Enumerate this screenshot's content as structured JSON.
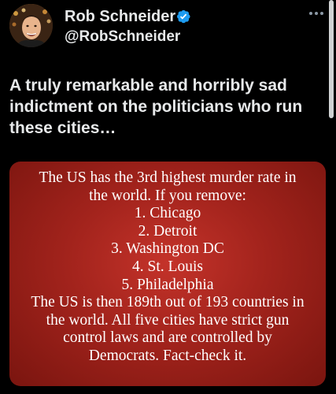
{
  "author": {
    "display_name": "Rob Schneider",
    "handle": "@RobSchneider",
    "verified": true
  },
  "tweet": {
    "text": "A truly remarkable and horribly sad indictment on the politicians who run these cities…"
  },
  "media": {
    "background_color": "#b32a22",
    "text_color": "#ffffff",
    "lines": [
      "The US has the 3rd highest murder rate in",
      "the world. If you remove:",
      "1. Chicago",
      "2. Detroit",
      "3. Washington DC",
      "4. St. Louis",
      "5. Philadelphia",
      "The US is then 189th out of 193 countries in",
      "the world. All five cities have strict gun",
      "control laws and are controlled by",
      "Democrats. Fact-check it."
    ]
  },
  "icons": {
    "verified": "verified-badge-icon",
    "more": "more-options-icon"
  },
  "colors": {
    "background": "#000000",
    "text": "#e7e9ea",
    "verified_blue": "#1d9bf0",
    "muted": "#8b98a5"
  }
}
